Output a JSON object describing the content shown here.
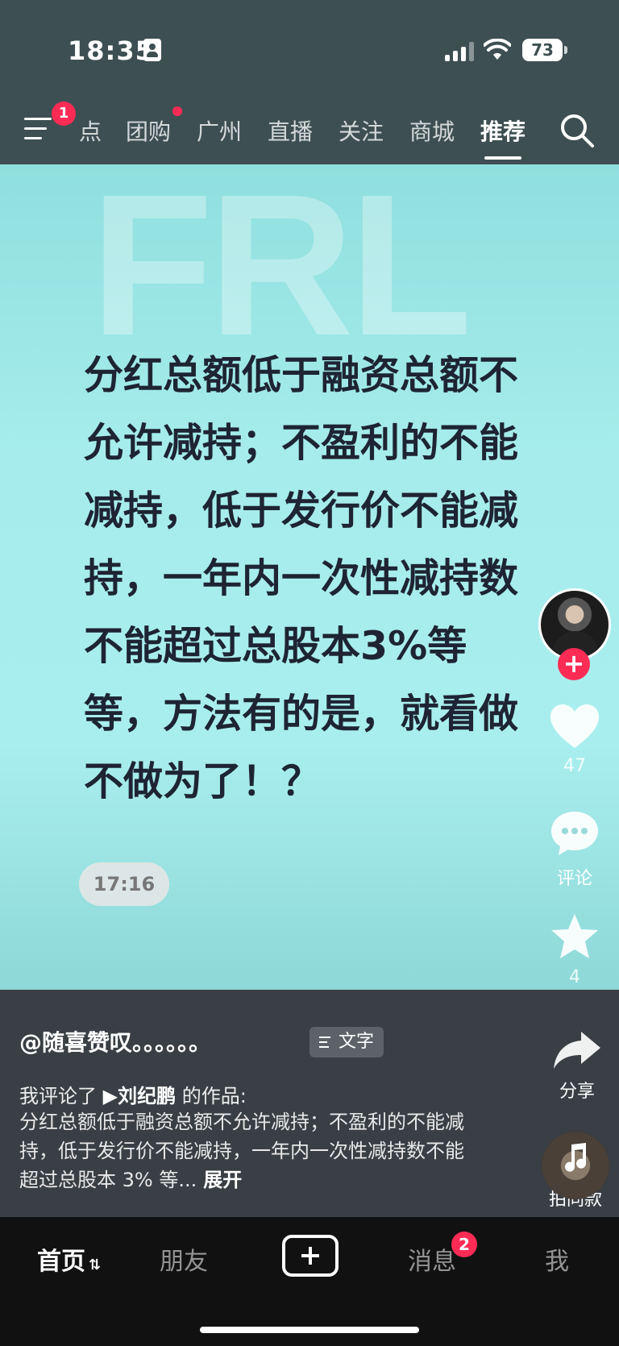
{
  "status_bar": {
    "time": "18:35",
    "battery": "73"
  },
  "nav": {
    "menu_badge": "1",
    "tabs": [
      {
        "label": "点"
      },
      {
        "label": "团购"
      },
      {
        "label": "广州"
      },
      {
        "label": "直播"
      },
      {
        "label": "关注"
      },
      {
        "label": "商城"
      },
      {
        "label": "推荐"
      }
    ],
    "active_tab": "推荐"
  },
  "video": {
    "watermark": "FRL",
    "overlay_text": "分红总额低于融资总额不允许减持；不盈利的不能减持，低于发行价不能减持，一年内一次性减持数不能超过总股本3%等等，方法有的是，就看做不做为了！？",
    "timestamp": "17:16"
  },
  "actions": {
    "likes": "47",
    "comment_label": "评论",
    "favorites": "4",
    "share_label": "分享",
    "music_label": "拍同款"
  },
  "info": {
    "author": "@随喜赞叹。。。。。。",
    "chip_label": "文字",
    "desc_head_prefix": "我评论了 ",
    "desc_head_name": "▶刘纪鹏",
    "desc_head_suffix": " 的作品:",
    "desc_body": "分红总额低于融资总额不允许减持；不盈利的不能减持，低于发行价不能减持，一年内一次性减持数不能超过总股本 3% 等...",
    "expand_label": "展开"
  },
  "tabbar": {
    "home": "首页",
    "friends": "朋友",
    "messages": "消息",
    "messages_badge": "2",
    "me": "我"
  },
  "colors": {
    "accent": "#fe2c55",
    "video_bg": "#a6ecec",
    "panel": "#3a3f45"
  }
}
